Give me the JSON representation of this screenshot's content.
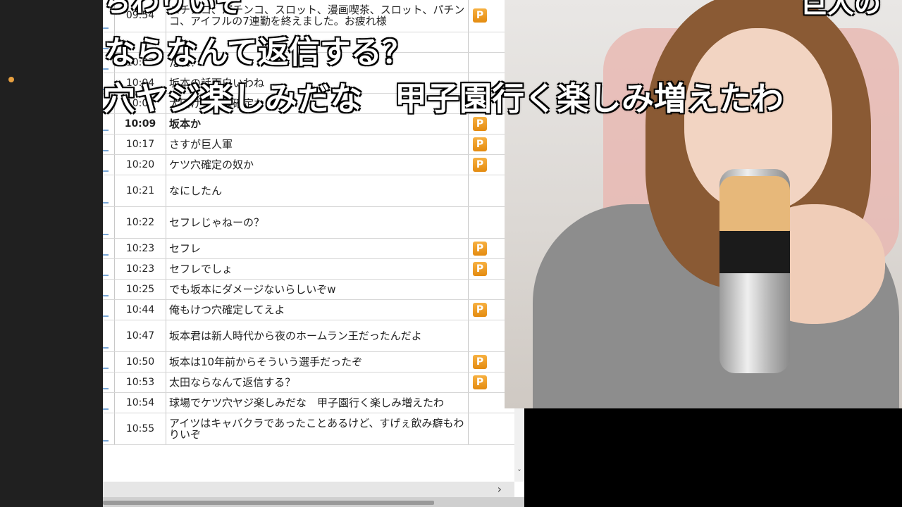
{
  "comments": [
    {
      "time": "09:54",
      "text": "パチンコ、パチンコ、スロット、漫画喫茶、スロット、パチンコ、アイフルの7連勤を終えました。お疲れ様",
      "badge": "P",
      "bold": false,
      "tall": true
    },
    {
      "time": "",
      "text": "",
      "badge": "",
      "bold": false,
      "tall": false
    },
    {
      "time": "10:03",
      "text": "だれ？",
      "badge": "",
      "bold": false,
      "tall": false
    },
    {
      "time": "10:04",
      "text": "坂本の話面白いわね",
      "badge": "",
      "bold": false,
      "tall": false
    },
    {
      "time": "10:05",
      "text": "太田けつあな確定な",
      "badge": "",
      "bold": false,
      "tall": false
    },
    {
      "time": "10:09",
      "text": "坂本か",
      "badge": "P",
      "bold": true,
      "tall": false
    },
    {
      "time": "10:17",
      "text": "さすが巨人軍",
      "badge": "P",
      "bold": false,
      "tall": false
    },
    {
      "time": "10:20",
      "text": "ケツ穴確定の奴か",
      "badge": "P",
      "bold": false,
      "tall": false
    },
    {
      "time": "10:21",
      "text": "なにしたん",
      "badge": "",
      "bold": false,
      "tall": true
    },
    {
      "time": "10:22",
      "text": "セフレじゃねーの？",
      "badge": "",
      "bold": false,
      "tall": true
    },
    {
      "time": "10:23",
      "text": "セフレ",
      "badge": "P",
      "bold": false,
      "tall": false
    },
    {
      "time": "10:23",
      "text": "セフレでしょ",
      "badge": "P",
      "bold": false,
      "tall": false
    },
    {
      "time": "10:25",
      "text": "でも坂本にダメージないらしいぞw",
      "badge": "",
      "bold": false,
      "tall": false
    },
    {
      "time": "10:44",
      "text": "俺もけつ穴確定してえよ",
      "badge": "P",
      "bold": false,
      "tall": false
    },
    {
      "time": "10:47",
      "text": "坂本君は新人時代から夜のホームラン王だったんだよ",
      "badge": "",
      "bold": false,
      "tall": true
    },
    {
      "time": "10:50",
      "text": "坂本は10年前からそういう選手だったぞ",
      "badge": "P",
      "bold": false,
      "tall": false
    },
    {
      "time": "10:53",
      "text": "太田ならなんて返信する？",
      "badge": "P",
      "bold": false,
      "tall": false
    },
    {
      "time": "10:54",
      "text": "球場でケツ穴ヤジ楽しみだな　甲子園行く楽しみ増えたわ",
      "badge": "",
      "bold": false,
      "tall": false
    },
    {
      "time": "10:55",
      "text": "アイツはキャバクラであったことあるけど、すげぇ飲み癖もわりいぞ",
      "badge": "",
      "bold": false,
      "tall": true
    }
  ],
  "overlay": {
    "line1": "ちわりいぞ",
    "line2": "ならなんて返信する？",
    "line3": "穴ヤジ楽しみだな　甲子園行く楽しみ増えたわ",
    "line4": "巨人の"
  },
  "scroll": {
    "right_arrow": "›",
    "down_arrow": "˅"
  },
  "colors": {
    "badge": "#f0a030",
    "accent_dot": "#e8a040"
  }
}
